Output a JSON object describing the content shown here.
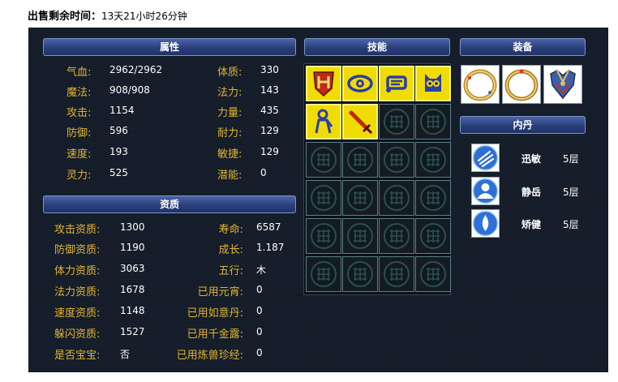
{
  "sale": {
    "label": "出售剩余时间：",
    "value": "13天21小时26分钟"
  },
  "attributes": {
    "header": "属性",
    "left": [
      {
        "key": "气血:",
        "value": "2962/2962"
      },
      {
        "key": "魔法:",
        "value": "908/908"
      },
      {
        "key": "攻击:",
        "value": "1154"
      },
      {
        "key": "防御:",
        "value": "596"
      },
      {
        "key": "速度:",
        "value": "193"
      },
      {
        "key": "灵力:",
        "value": "525"
      }
    ],
    "right": [
      {
        "key": "体质:",
        "value": "330"
      },
      {
        "key": "法力:",
        "value": "143"
      },
      {
        "key": "力量:",
        "value": "435"
      },
      {
        "key": "耐力:",
        "value": "129"
      },
      {
        "key": "敏捷:",
        "value": "129"
      },
      {
        "key": "潜能:",
        "value": "0"
      }
    ]
  },
  "qualities": {
    "header": "资质",
    "left": [
      {
        "key": "攻击资质:",
        "value": "1300"
      },
      {
        "key": "防御资质:",
        "value": "1190"
      },
      {
        "key": "体力资质:",
        "value": "3063"
      },
      {
        "key": "法力资质:",
        "value": "1678"
      },
      {
        "key": "速度资质:",
        "value": "1148"
      },
      {
        "key": "躲闪资质:",
        "value": "1527"
      },
      {
        "key": "是否宝宝:",
        "value": "否"
      }
    ],
    "right": [
      {
        "key": "寿命:",
        "value": "6587"
      },
      {
        "key": "成长:",
        "value": "1.187"
      },
      {
        "key": "五行:",
        "value": "木"
      },
      {
        "key": "已用元宵:",
        "value": "0"
      },
      {
        "key": "已用如意丹:",
        "value": "0"
      },
      {
        "key": "已用千金露:",
        "value": "0"
      },
      {
        "key": "已用炼兽珍经:",
        "value": "0"
      }
    ]
  },
  "skills": {
    "header": "技能",
    "items": [
      {
        "icon": "shield-rune-icon",
        "color": "#c02818"
      },
      {
        "icon": "eye-icon",
        "color": "#2a3ea8"
      },
      {
        "icon": "scroll-icon",
        "color": "#2a3ea8"
      },
      {
        "icon": "owl-icon",
        "color": "#2a3ea8"
      },
      {
        "icon": "monk-icon",
        "color": "#2a3ea8"
      },
      {
        "icon": "sword-icon",
        "color": "#c02818"
      }
    ],
    "slots": 24
  },
  "equipment": {
    "header": "装备",
    "items": [
      {
        "icon": "ring-icon"
      },
      {
        "icon": "ring-icon"
      },
      {
        "icon": "armor-icon"
      }
    ]
  },
  "neidan": {
    "header": "内丹",
    "items": [
      {
        "name": "迅敏",
        "level": "5层",
        "icon": "swift-icon"
      },
      {
        "name": "静岳",
        "level": "5层",
        "icon": "mountain-icon"
      },
      {
        "name": "矫健",
        "level": "5层",
        "icon": "drop-icon"
      }
    ]
  }
}
